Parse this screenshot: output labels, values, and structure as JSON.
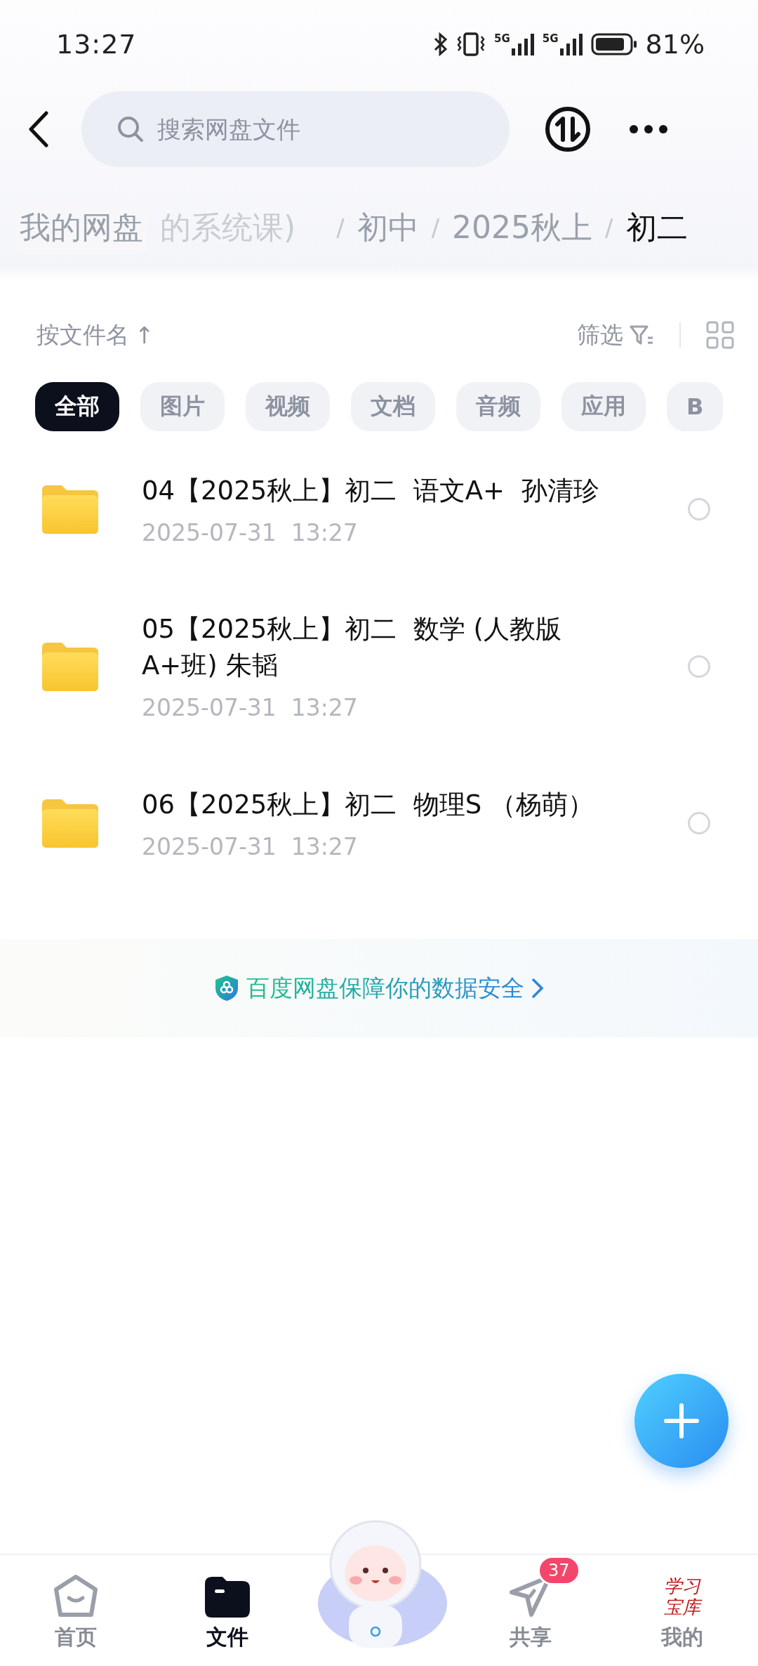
{
  "status_bar": {
    "time": "13:27",
    "signals": [
      {
        "network": "5G"
      },
      {
        "network": "5G"
      }
    ],
    "battery": "81%"
  },
  "header": {
    "search": {
      "placeholder": "搜索网盘文件"
    }
  },
  "breadcrumb": [
    {
      "label": "我的网盘",
      "selected": false
    },
    {
      "label": "的系统课)",
      "selected": false
    },
    {
      "separator": "/",
      "label": "初中",
      "selected": false
    },
    {
      "separator": "/",
      "label": "2025秋上",
      "selected": false
    },
    {
      "separator": "/",
      "label": "初二",
      "selected": true
    }
  ],
  "toolbar": {
    "sort": "按文件名",
    "sort_arrow": "↑",
    "filter": "筛选"
  },
  "chips": [
    {
      "label": "全部",
      "selected": true
    },
    {
      "label": "图片",
      "selected": false
    },
    {
      "label": "视频",
      "selected": false
    },
    {
      "label": "文档",
      "selected": false
    },
    {
      "label": "音频",
      "selected": false
    },
    {
      "label": "应用",
      "selected": false
    },
    {
      "label": "B",
      "selected": false
    }
  ],
  "files": [
    {
      "name": "04【2025秋上】初二  语文A+  孙清珍",
      "date": "2025-07-31  13:27",
      "selected": false
    },
    {
      "name": "05【2025秋上】初二  数学 (人教版A+班) 朱韬",
      "date": "2025-07-31  13:27",
      "selected": false
    },
    {
      "name": "06【2025秋上】初二  物理S （杨萌）",
      "date": "2025-07-31  13:27",
      "selected": false
    }
  ],
  "banner": {
    "text": "百度网盘保障你的数据安全"
  },
  "nav": [
    {
      "kind": "home",
      "label": "首页",
      "selected": false
    },
    {
      "kind": "files",
      "label": "文件",
      "selected": true
    },
    {
      "kind": "mascot",
      "selected": false
    },
    {
      "kind": "share",
      "label": "共享",
      "selected": false,
      "badge": "37"
    },
    {
      "kind": "profile",
      "label": "我的",
      "selected": false,
      "avatar_text": "学习宝库"
    }
  ]
}
